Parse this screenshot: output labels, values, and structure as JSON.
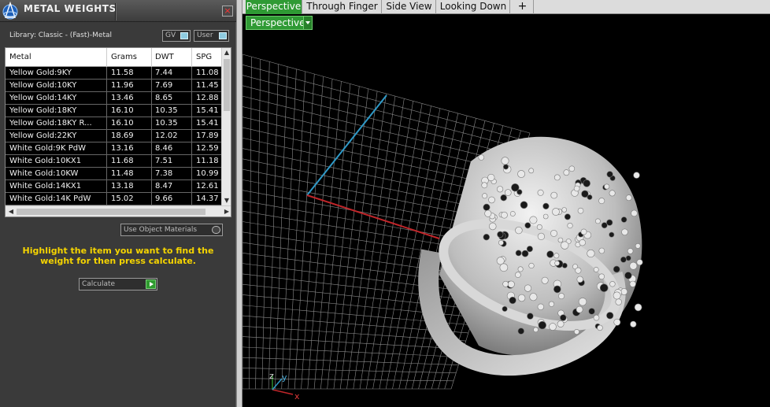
{
  "panel": {
    "title": "METAL WEIGHTS",
    "close_glyph": "⊠",
    "library_label": "Library: Classic - (Fast)-Metal",
    "toggle_gv": "GV",
    "toggle_user": "User",
    "use_object_materials": "Use Object Materials",
    "instructions": "Highlight the item you want to find the weight for then press calculate.",
    "calculate_label": "Calculate"
  },
  "table": {
    "columns": [
      "Metal",
      "Grams",
      "DWT",
      "SPG"
    ],
    "rows": [
      {
        "metal": "Yellow Gold:9KY",
        "grams": "11.58",
        "dwt": "7.44",
        "spg": "11.08"
      },
      {
        "metal": "Yellow Gold:10KY",
        "grams": "11.96",
        "dwt": "7.69",
        "spg": "11.45"
      },
      {
        "metal": "Yellow Gold:14KY",
        "grams": "13.46",
        "dwt": "8.65",
        "spg": "12.88"
      },
      {
        "metal": "Yellow Gold:18KY",
        "grams": "16.10",
        "dwt": "10.35",
        "spg": "15.41"
      },
      {
        "metal": "Yellow Gold:18KY R...",
        "grams": "16.10",
        "dwt": "10.35",
        "spg": "15.41"
      },
      {
        "metal": "Yellow Gold:22KY",
        "grams": "18.69",
        "dwt": "12.02",
        "spg": "17.89"
      },
      {
        "metal": "White Gold:9K PdW",
        "grams": "13.16",
        "dwt": "8.46",
        "spg": "12.59"
      },
      {
        "metal": "White Gold:10KX1",
        "grams": "11.68",
        "dwt": "7.51",
        "spg": "11.18"
      },
      {
        "metal": "White Gold:10KW",
        "grams": "11.48",
        "dwt": "7.38",
        "spg": "10.99"
      },
      {
        "metal": "White Gold:14KX1",
        "grams": "13.18",
        "dwt": "8.47",
        "spg": "12.61"
      },
      {
        "metal": "White Gold:14K PdW",
        "grams": "15.02",
        "dwt": "9.66",
        "spg": "14.37"
      }
    ]
  },
  "tabs": [
    {
      "label": "Perspective",
      "active": true
    },
    {
      "label": "Through Finger",
      "active": false
    },
    {
      "label": "Side View",
      "active": false
    },
    {
      "label": "Looking Down",
      "active": false
    }
  ],
  "tab_add_glyph": "+",
  "viewport": {
    "label": "Perspective",
    "axis_x": "x",
    "axis_y": "y",
    "axis_z": "z"
  },
  "colors": {
    "accent": "#2f9a34",
    "instruction_text": "#f5d400",
    "grid_line": "#8a8a8a",
    "x_axis": "#c0262a",
    "y_axis": "#2f9ac8",
    "ring": "#cfcfcf"
  }
}
